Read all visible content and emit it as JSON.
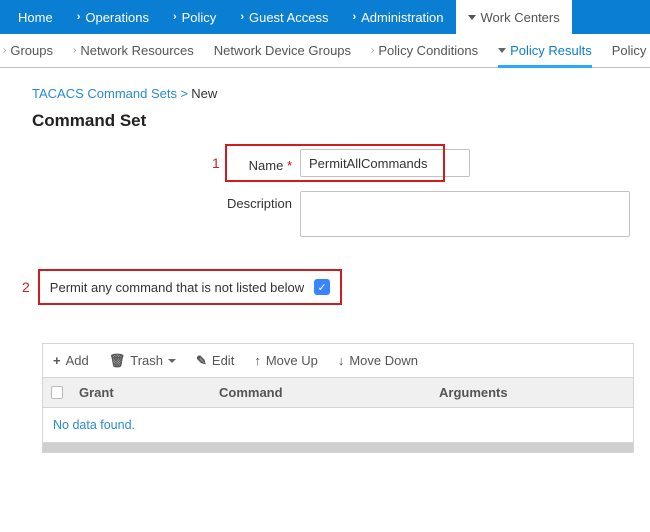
{
  "topnav": {
    "home": "Home",
    "operations": "Operations",
    "policy": "Policy",
    "guest": "Guest Access",
    "admin": "Administration",
    "work": "Work Centers"
  },
  "subnav": {
    "groups": "Groups",
    "netres": "Network Resources",
    "ndg": "Network Device Groups",
    "polcond": "Policy Conditions",
    "polres": "Policy Results",
    "polsets": "Policy Sets"
  },
  "breadcrumb": {
    "parent": "TACACS Command Sets",
    "sep": ">",
    "current": "New"
  },
  "page": {
    "title": "Command Set"
  },
  "form": {
    "name_label": "Name",
    "name_value": "PermitAllCommands",
    "desc_label": "Description",
    "permit_label": "Permit any command that is not listed below"
  },
  "callouts": {
    "one": "1",
    "two": "2"
  },
  "toolbar": {
    "add": "Add",
    "trash": "Trash",
    "edit": "Edit",
    "moveup": "Move Up",
    "movedown": "Move Down"
  },
  "grid": {
    "col1": "Grant",
    "col2": "Command",
    "col3": "Arguments",
    "nodata": "No data found."
  }
}
